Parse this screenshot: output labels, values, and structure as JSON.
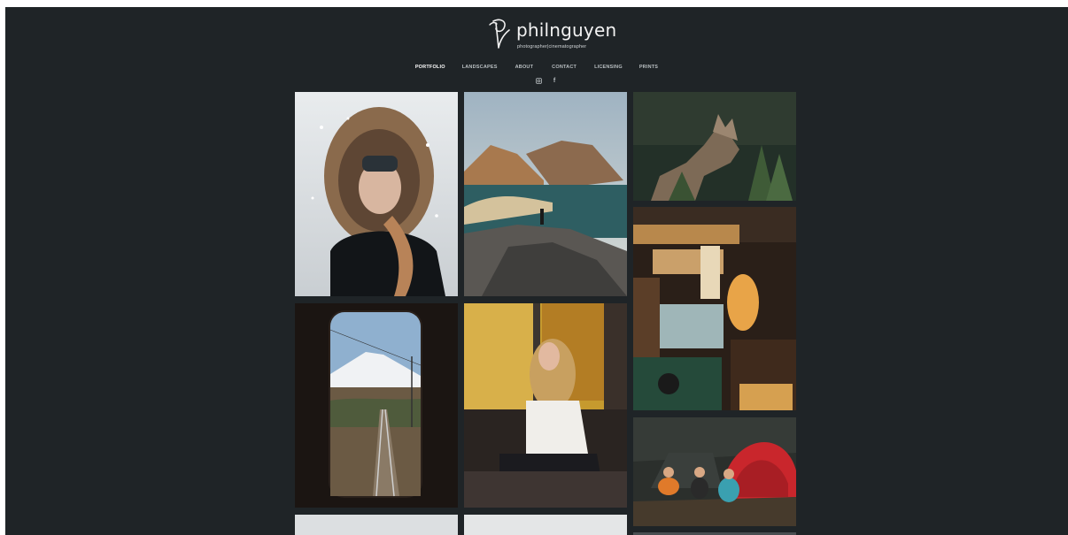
{
  "site": {
    "name": "philnguyen",
    "tagline": "photographer|cinematographer"
  },
  "nav": {
    "items": [
      {
        "label": "PORTFOLIO",
        "active": true
      },
      {
        "label": "LANDSCAPES",
        "active": false
      },
      {
        "label": "ABOUT",
        "active": false
      },
      {
        "label": "CONTACT",
        "active": false
      },
      {
        "label": "LICENSING",
        "active": false
      },
      {
        "label": "PRINTS",
        "active": false
      }
    ]
  },
  "social": {
    "icons": [
      "instagram-icon",
      "facebook-icon"
    ],
    "facebook_glyph": "f"
  },
  "colors": {
    "background": "#1f2427",
    "nav_active": "#ffffff",
    "nav_inactive": "#b9bfc2"
  },
  "gallery": {
    "photos": [
      {
        "name": "photo-woman-snow-hood"
      },
      {
        "name": "photo-fjord-mountains"
      },
      {
        "name": "photo-wolf-forest"
      },
      {
        "name": "photo-japanese-food-stall"
      },
      {
        "name": "photo-train-window-fuji"
      },
      {
        "name": "photo-woman-train-window"
      },
      {
        "name": "photo-camping-tent-night"
      },
      {
        "name": "photo-partial-1"
      },
      {
        "name": "photo-partial-2"
      },
      {
        "name": "photo-partial-3"
      }
    ]
  }
}
